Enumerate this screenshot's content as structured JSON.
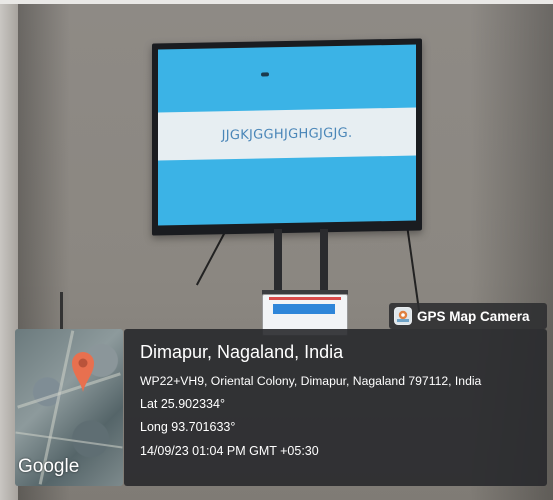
{
  "screen": {
    "text": "JJGKJGGHJGHGJGJG."
  },
  "overlay": {
    "app_name": "GPS Map Camera",
    "location_title": "Dimapur, Nagaland, India",
    "address": "WP22+VH9, Oriental Colony, Dimapur, Nagaland 797112, India",
    "latitude": "Lat 25.902334°",
    "longitude": "Long 93.701633°",
    "datetime": "14/09/23 01:04 PM GMT +05:30",
    "map_logo": "Google"
  },
  "colors": {
    "screen_blue": "#3bb3e6",
    "pin_orange": "#e8704f",
    "panel_dark": "#28292c"
  },
  "icons": [
    "map-pin-icon",
    "gps-camera-icon"
  ]
}
